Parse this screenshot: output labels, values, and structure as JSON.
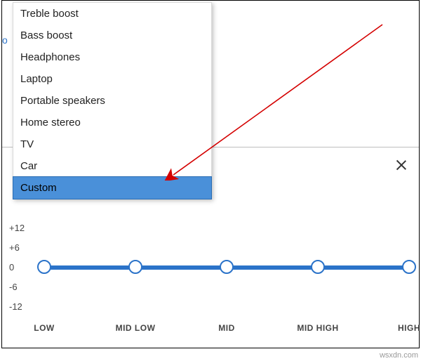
{
  "side_hint": "o",
  "dropdown": {
    "items": [
      {
        "label": "Treble boost",
        "selected": false
      },
      {
        "label": "Bass boost",
        "selected": false
      },
      {
        "label": "Headphones",
        "selected": false
      },
      {
        "label": "Laptop",
        "selected": false
      },
      {
        "label": "Portable speakers",
        "selected": false
      },
      {
        "label": "Home stereo",
        "selected": false
      },
      {
        "label": "TV",
        "selected": false
      },
      {
        "label": "Car",
        "selected": false
      },
      {
        "label": "Custom",
        "selected": true
      }
    ]
  },
  "panel": {
    "close_label": "Close"
  },
  "eq": {
    "y_ticks": [
      "+12",
      "+6",
      "0",
      "-6",
      "-12"
    ],
    "bands": [
      {
        "name": "LOW",
        "value": 0
      },
      {
        "name": "MID LOW",
        "value": 0
      },
      {
        "name": "MID",
        "value": 0
      },
      {
        "name": "MID HIGH",
        "value": 0
      },
      {
        "name": "HIGH",
        "value": 0
      }
    ],
    "range": [
      -12,
      12
    ]
  },
  "watermark": "wsxdn.com",
  "chart_data": {
    "type": "line",
    "title": "",
    "xlabel": "",
    "ylabel": "",
    "ylim": [
      -12,
      12
    ],
    "y_ticks": [
      12,
      6,
      0,
      -6,
      -12
    ],
    "categories": [
      "LOW",
      "MID LOW",
      "MID",
      "MID HIGH",
      "HIGH"
    ],
    "values": [
      0,
      0,
      0,
      0,
      0
    ]
  }
}
